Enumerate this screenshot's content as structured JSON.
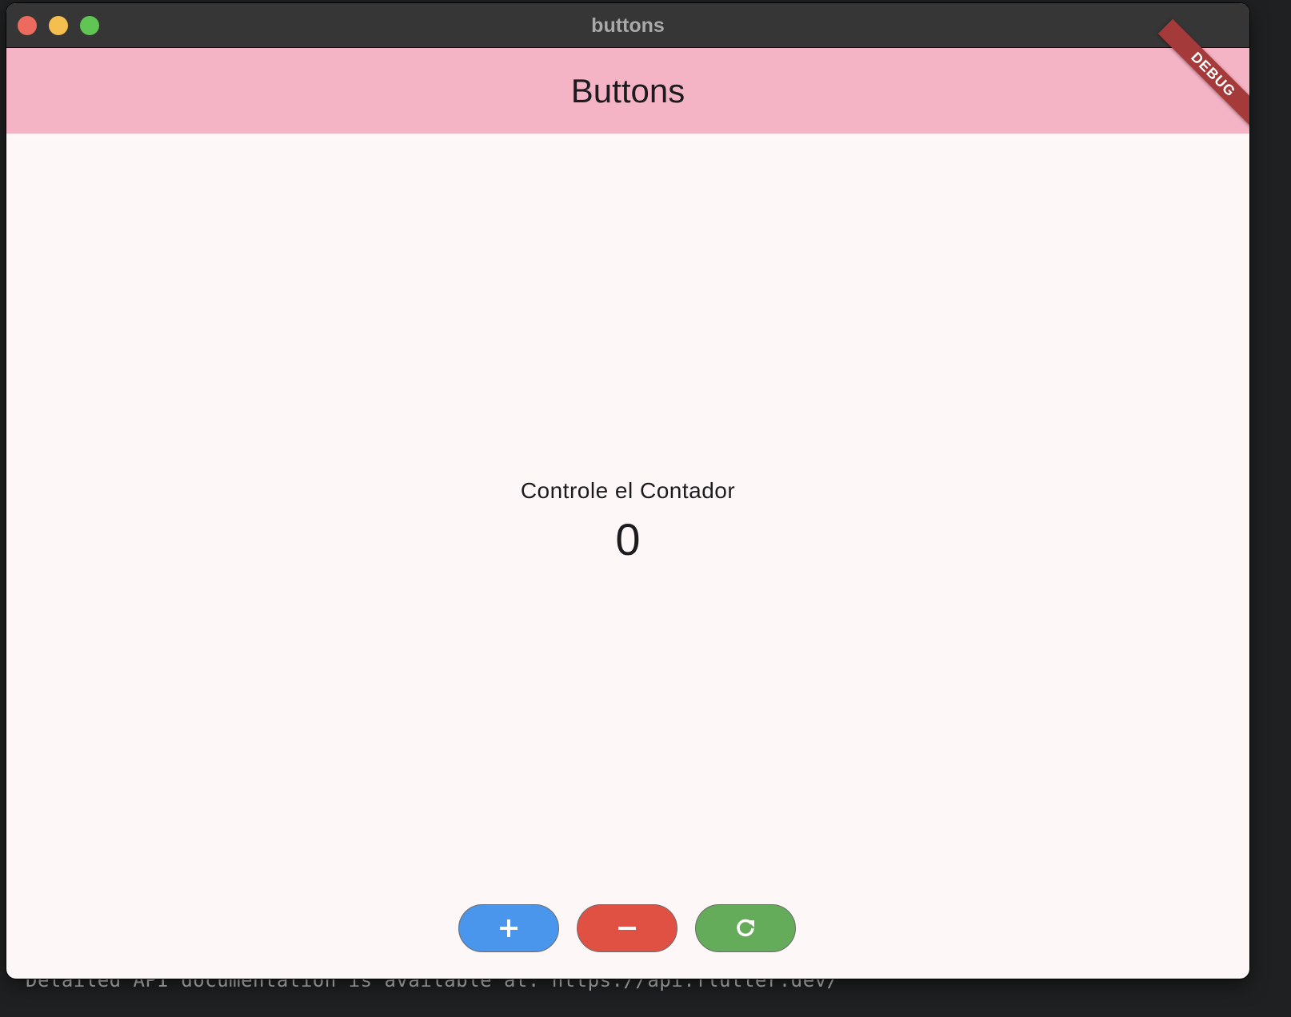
{
  "background_terminal": {
    "visible_line": "Detailed API documentation is available at: https://api.flutter.dev/"
  },
  "window": {
    "title": "buttons",
    "controls": [
      "close",
      "minimize",
      "maximize"
    ]
  },
  "appbar": {
    "title": "Buttons",
    "background_color": "#f4b4c6",
    "debug_banner": "DEBUG"
  },
  "content": {
    "label": "Controle el Contador",
    "counter_value": "0"
  },
  "buttons": [
    {
      "icon": "plus-icon",
      "color": "#4996ec"
    },
    {
      "icon": "minus-icon",
      "color": "#e15143"
    },
    {
      "icon": "refresh-icon",
      "color": "#64ab5a"
    }
  ]
}
